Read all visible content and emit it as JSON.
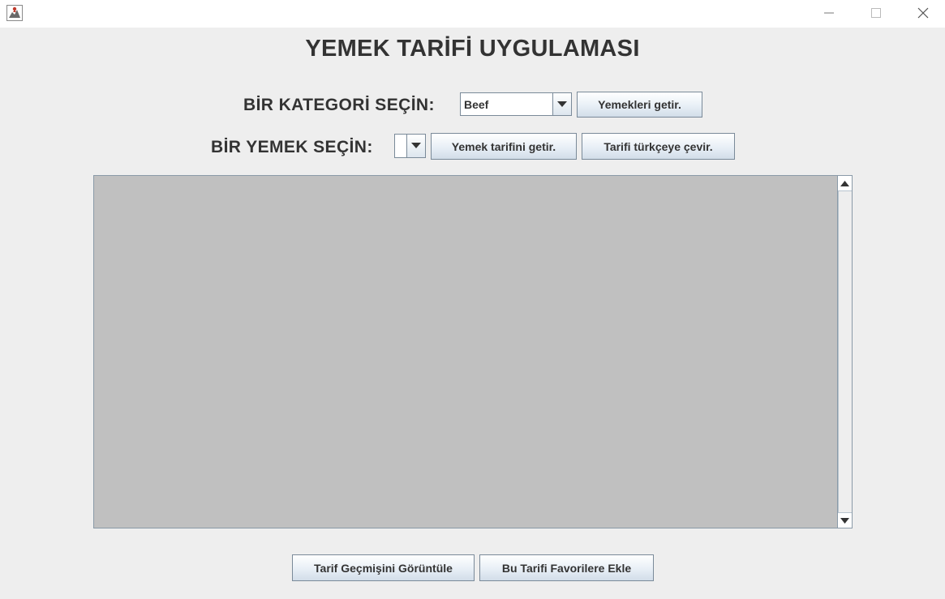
{
  "window": {
    "icon": "java-app-icon",
    "controls": [
      "minimize-icon",
      "maximize-icon",
      "close-icon"
    ]
  },
  "header": {
    "title": "YEMEK TARİFİ UYGULAMASI"
  },
  "category_row": {
    "label": "BİR KATEGORİ SEÇİN:",
    "selected_category": "Beef",
    "fetch_button": "Yemekleri getir."
  },
  "meal_row": {
    "label": "BİR YEMEK SEÇİN:",
    "selected_meal": "",
    "recipe_button": "Yemek tarifini getir.",
    "translate_button": "Tarifi türkçeye çevir."
  },
  "recipe_area": {
    "content": ""
  },
  "footer": {
    "history_button": "Tarif Geçmişini Görüntüle",
    "favorite_button": "Bu Tarifi Favorilere Ekle"
  },
  "colors": {
    "panel_bg": "#eeeeee",
    "text_area_bg": "#c0c0c0",
    "text": "#333333",
    "button_border": "#7a8a99"
  }
}
